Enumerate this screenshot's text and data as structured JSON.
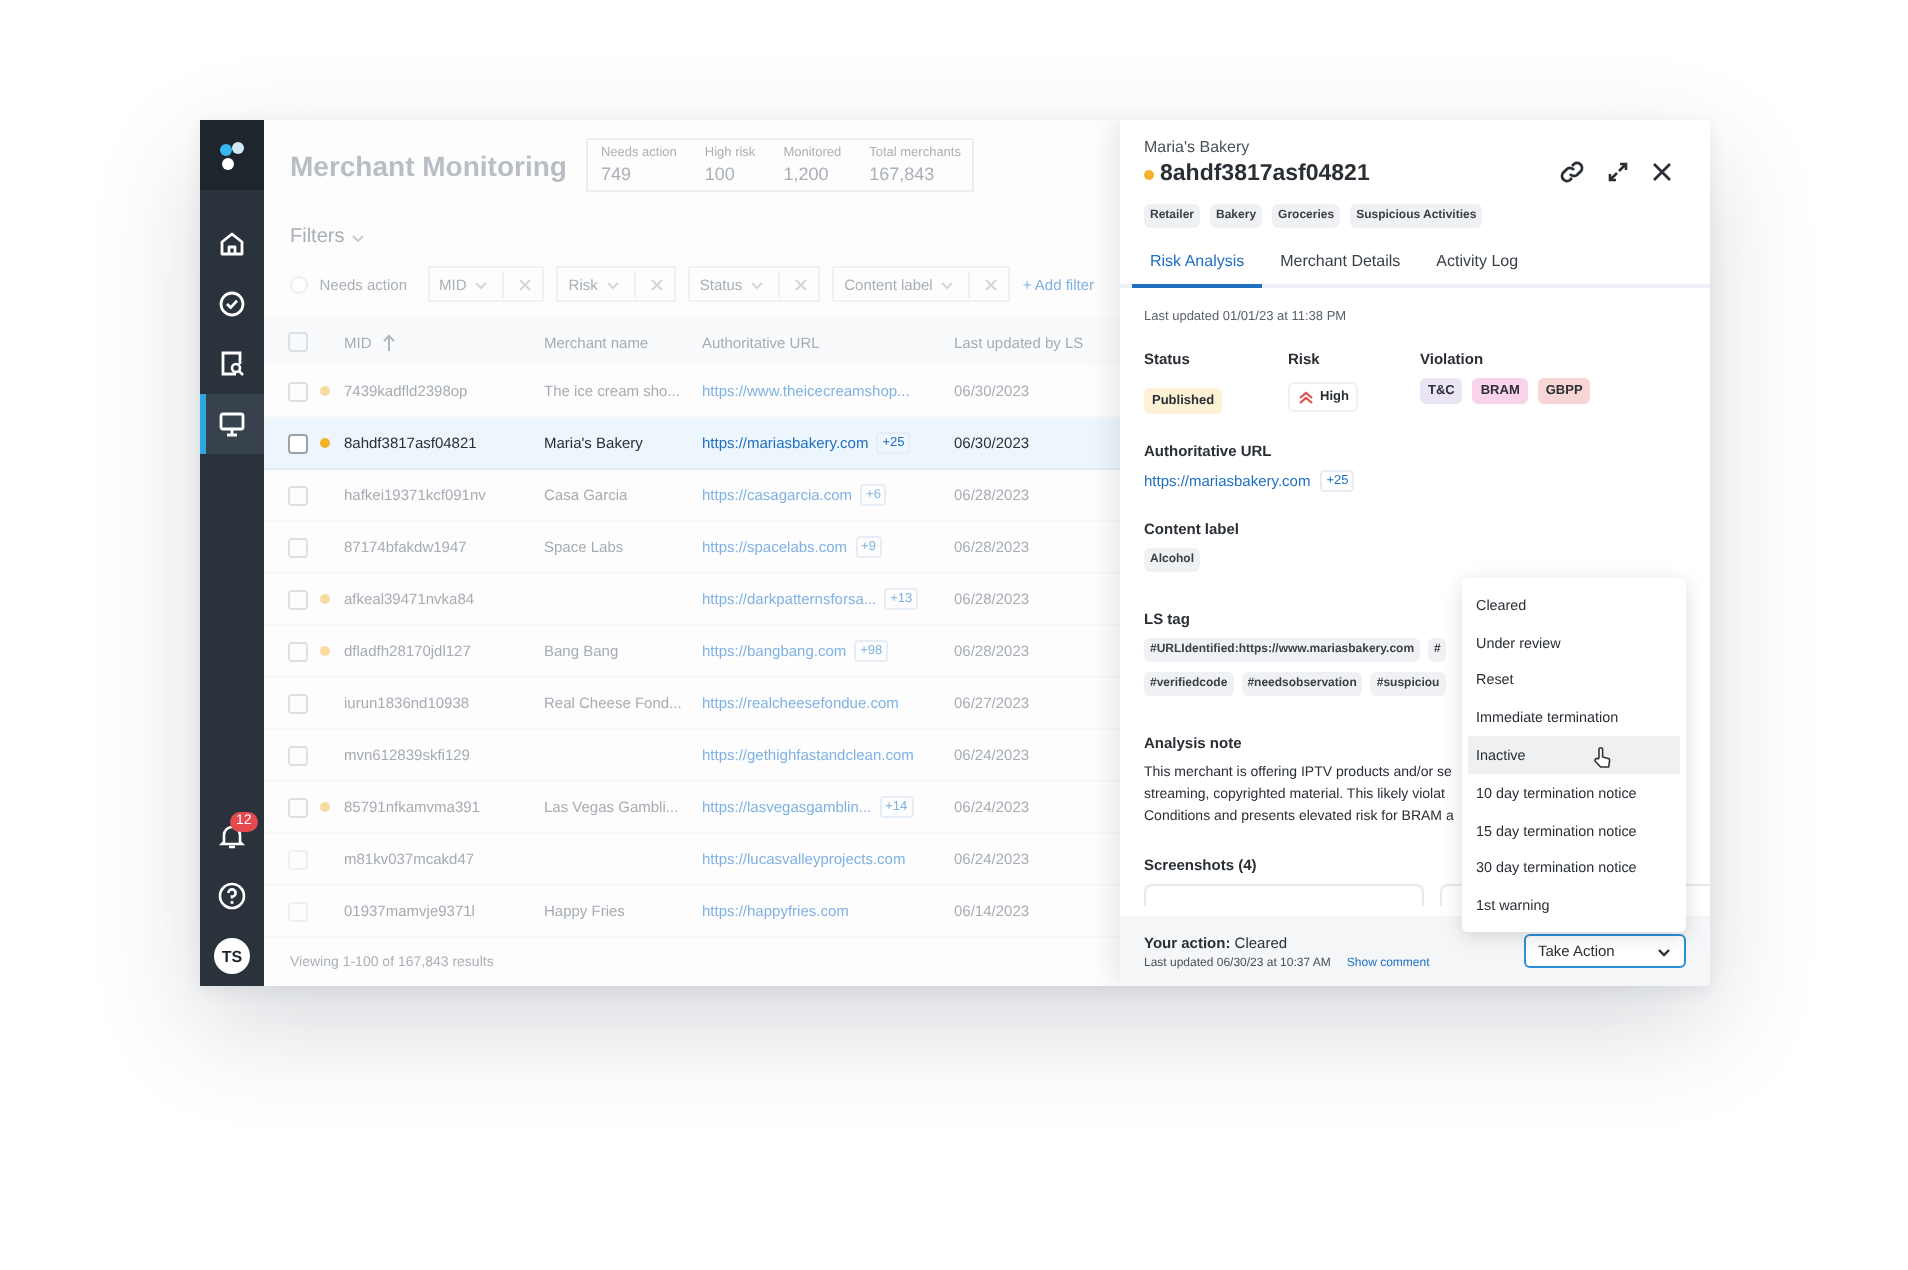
{
  "sidebar": {
    "items": [
      {
        "kind": "home",
        "selected": false
      },
      {
        "kind": "check",
        "selected": false
      },
      {
        "kind": "search-doc",
        "selected": false
      },
      {
        "kind": "monitor",
        "selected": true
      }
    ],
    "notifications": "12",
    "avatar": "TS"
  },
  "header": {
    "title": "Merchant Monitoring",
    "stats": [
      {
        "label": "Needs action",
        "value": "749"
      },
      {
        "label": "High risk",
        "value": "100"
      },
      {
        "label": "Monitored",
        "value": "1,200"
      },
      {
        "label": "Total merchants",
        "value": "167,843"
      }
    ]
  },
  "filters": {
    "title": "Filters",
    "toggle": {
      "label": "Needs action",
      "on": false
    },
    "chips": [
      "MID",
      "Risk",
      "Status",
      "Content label"
    ],
    "add": "+ Add filter"
  },
  "table": {
    "all_checked": false,
    "columns": [
      {
        "label": "MID",
        "sorted": true
      },
      {
        "label": "Merchant name",
        "sorted": false
      },
      {
        "label": "Authoritative URL",
        "sorted": false
      },
      {
        "label": "Last updated by LS",
        "sorted": false
      }
    ],
    "rows": [
      {
        "mid": "7439kadfld2398op",
        "name": "The ice cream sho...",
        "url": "https://www.theicecreamshop...",
        "date": "06/30/2023",
        "flagged": true,
        "selected": false
      },
      {
        "mid": "8ahdf3817asf04821",
        "name": "Maria's Bakery",
        "url": "https://mariasbakery.com",
        "extra": "+25",
        "date": "06/30/2023",
        "flagged": true,
        "selected": true
      },
      {
        "mid": "hafkei19371kcf091nv",
        "name": "Casa Garcia",
        "url": "https://casagarcia.com",
        "extra": "+6",
        "date": "06/28/2023",
        "flagged": false,
        "selected": false
      },
      {
        "mid": "87174bfakdw1947",
        "name": "Space Labs",
        "url": "https://spacelabs.com",
        "extra": "+9",
        "date": "06/28/2023",
        "flagged": false,
        "selected": false
      },
      {
        "mid": "afkeal39471nvka84",
        "url": "https://darkpatternsforsa...",
        "extra": "+13",
        "date": "06/28/2023",
        "flagged": true,
        "selected": false
      },
      {
        "mid": "dfladfh28170jdl127",
        "name": "Bang Bang",
        "url": "https://bangbang.com",
        "extra": "+98",
        "date": "06/28/2023",
        "flagged": true,
        "selected": false
      },
      {
        "mid": "iurun1836nd10938",
        "name": "Real Cheese Fond...",
        "url": "https://realcheesefondue.com",
        "date": "06/27/2023",
        "flagged": false,
        "selected": false
      },
      {
        "mid": "mvn612839skfi129",
        "url": "https://gethighfastandclean.com",
        "date": "06/24/2023",
        "flagged": false,
        "selected": false
      },
      {
        "mid": "85791nfkamvma391",
        "name": "Las Vegas Gambli...",
        "url": "https://lasvegasgamblin...",
        "extra": "+14",
        "date": "06/24/2023",
        "flagged": true,
        "selected": false
      },
      {
        "mid": "m81kv037mcakd47",
        "url": "https://lucasvalleyprojects.com",
        "date": "06/24/2023",
        "flagged": false,
        "selected": false
      },
      {
        "mid": "01937mamvje9371l",
        "name": "Happy Fries",
        "url": "https://happyfries.com",
        "date": "06/14/2023",
        "flagged": false,
        "selected": false
      }
    ],
    "footer": "Viewing 1-100 of 167,843 results"
  },
  "panel": {
    "subtitle": "Maria's Bakery",
    "title": "8ahdf3817asf04821",
    "flagged": true,
    "tags": [
      "Retailer",
      "Bakery",
      "Groceries",
      "Suspicious Activities"
    ],
    "tabs": [
      {
        "label": "Risk Analysis",
        "selected": true
      },
      {
        "label": "Merchant Details",
        "selected": false
      },
      {
        "label": "Activity Log",
        "selected": false
      }
    ],
    "updated": "Last updated 01/01/23 at 11:38 PM",
    "status": {
      "label": "Status",
      "value": "Published"
    },
    "risk": {
      "label": "Risk",
      "value": "High"
    },
    "violation": {
      "label": "Violation",
      "items": [
        {
          "label": "T&C",
          "color": "#ebe4f4"
        },
        {
          "label": "BRAM",
          "color": "#f8d3ea"
        },
        {
          "label": "GBPP",
          "color": "#f9d6d6"
        }
      ]
    },
    "url": {
      "label": "Authoritative URL",
      "value": "https://mariasbakery.com",
      "extra": "+25"
    },
    "content_label": {
      "label": "Content label",
      "tags": [
        "Alcohol"
      ]
    },
    "ls_tag": {
      "label": "LS tag",
      "tags": [
        "#URLIdentified:https://www.mariasbakery.com",
        "#",
        "#verifiedcode",
        "#needsobservation",
        "#suspiciou"
      ]
    },
    "analysis": {
      "label": "Analysis note",
      "lines": [
        "This merchant is offering IPTV products and/or se",
        "streaming, copyrighted material. This likely violat",
        "Conditions and presents elevated risk for BRAM a"
      ]
    },
    "screenshots": {
      "label": "Screenshots (4)"
    },
    "footer": {
      "action": "**Your action:** Cleared",
      "updated": "Last updated 06/30/23 at 10:37 AM",
      "link": "Show comment",
      "button": "Take Action"
    },
    "menu": {
      "items": [
        {
          "label": "Cleared",
          "highlighted": false
        },
        {
          "label": "Under review",
          "highlighted": false
        },
        {
          "label": "Reset",
          "highlighted": false
        },
        {
          "label": "Immediate termination",
          "highlighted": false
        },
        {
          "label": "Inactive",
          "highlighted": true
        },
        {
          "label": "10 day termination notice",
          "highlighted": false
        },
        {
          "label": "15 day termination notice",
          "highlighted": false
        },
        {
          "label": "30 day termination notice",
          "highlighted": false
        },
        {
          "label": "1st warning",
          "highlighted": false
        }
      ]
    }
  }
}
